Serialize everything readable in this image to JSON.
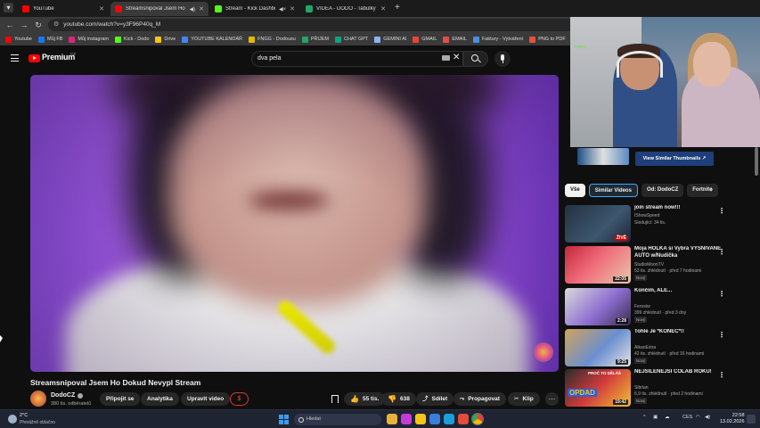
{
  "browser": {
    "tabs": [
      {
        "title": "YouTube",
        "color": "#ff0000"
      },
      {
        "title": "Streamsnipoval Jsem Ho Do",
        "color": "#ff0000"
      },
      {
        "title": "Stream - Kick Dashboard",
        "color": "#53fc18"
      },
      {
        "title": "VIDEA - DODO - Tabulky Googl",
        "color": "#23a566"
      }
    ],
    "new_tab": "+",
    "url": "youtube.com/watch?v=y3F96P40q_M"
  },
  "bookmarks": [
    {
      "label": "Youtube",
      "color": "#ff0000"
    },
    {
      "label": "Můj FB",
      "color": "#1877f2"
    },
    {
      "label": "Můj instagram",
      "color": "#d62976"
    },
    {
      "label": "Kick - Dodo",
      "color": "#53fc18"
    },
    {
      "label": "Drive",
      "color": "#f5c518"
    },
    {
      "label": "YOUTUBE KALENDÁŘ",
      "color": "#4285f4"
    },
    {
      "label": "FNGG - Dodousu",
      "color": "#e6b800"
    },
    {
      "label": "PŘIJEM",
      "color": "#23a566"
    },
    {
      "label": "CHAT GPT",
      "color": "#10a37f"
    },
    {
      "label": "GEMINI AI",
      "color": "#8ab4f8"
    },
    {
      "label": "GMAIL",
      "color": "#ea4335"
    },
    {
      "label": "EMAIL",
      "color": "#e34c4c"
    },
    {
      "label": "Faktury - Vytváření",
      "color": "#4a90e2"
    },
    {
      "label": "PNG to PDF",
      "color": "#e94f3d"
    }
  ],
  "youtube": {
    "brand": "Premium",
    "country": "CZ",
    "search_query": "dva pela"
  },
  "video": {
    "title": "Streamsnipoval Jsem Ho Dokud Nevypl Stream",
    "channel": "DodoCZ",
    "subscribers": "380 tis. odběratelů",
    "buttons": {
      "join": "Připojit se",
      "analytics": "Analytika",
      "edit": "Upravit video",
      "super": "$",
      "likes": "55 tis.",
      "dislikes": "638",
      "share": "Sdílet",
      "promote": "Propagovat",
      "clip": "Klip",
      "more": "…"
    }
  },
  "webcam": {
    "label": "ÝMÍNO",
    "similar_thumbnails": "View Similar Thumbnails ↗"
  },
  "chips": [
    "Vše",
    "Similar Videos",
    "Od: DodoCZ",
    "Fortnite"
  ],
  "recommendations": [
    {
      "title": "join stream now!!!",
      "channel": "IShowSpeed",
      "meta": "Sledující: 34 tis.",
      "badge": "",
      "dur": "ŽIVĚ",
      "live": true,
      "thumb": "linear-gradient(135deg,#233240,#3e5670 60%,#1c2733)"
    },
    {
      "title": "Moja HOLKA si Vybrá VYSNÍVANÉ AUTO w/Nudička",
      "channel": "StudioMoonTV",
      "meta": "53 tis. zhlédnutí · před 7 hodinami",
      "badge": "Nový",
      "dur": "22:05",
      "live": false,
      "thumb": "linear-gradient(135deg,#c2283a,#f06b7a 45%,#e7c8a8)"
    },
    {
      "title": "Končím, ALE...",
      "channel": "Ferostw",
      "meta": "399 zhlédnutí · před 3 dny",
      "badge": "Nový",
      "dur": "2:28",
      "live": false,
      "thumb": "linear-gradient(135deg,#d9d9d9,#8e6fd1 55%,#3a2c4f)"
    },
    {
      "title": "Tohle Je *KONEC*!!",
      "channel": "AlkanExtra",
      "meta": "42 tis. zhlédnutí · před 16 hodinami",
      "badge": "Nový",
      "dur": "9:25",
      "live": false,
      "thumb": "linear-gradient(135deg,#d0a25d,#6a8fd0 55%,#e4e4e4)"
    },
    {
      "title": "NEJŠÍLENĚJŠÍ COLAB ROKU!",
      "channel": "Sibrlan",
      "meta": "6,9 tis. zhlédnutí · před 2 hodinami",
      "badge": "Nový",
      "dur": "19:42",
      "live": false,
      "thumb": "linear-gradient(135deg,#2b2b2b,#d23b3b 50%,#f1c232)"
    }
  ],
  "rec_thumb_text": [
    "OPDAD",
    "PROČ TO DĚLÁŠ"
  ],
  "taskbar": {
    "temp": "2°C",
    "weather": "Převážně oblačno",
    "search_placeholder": "Hledat",
    "lang": "CES",
    "time": "22:58",
    "date": "13.02.2026",
    "app_colors": [
      "#e8b13a",
      "#c63ad8",
      "#f5c518",
      "#3b7ddd",
      "#1c9fd8",
      "#e34c3b"
    ]
  }
}
